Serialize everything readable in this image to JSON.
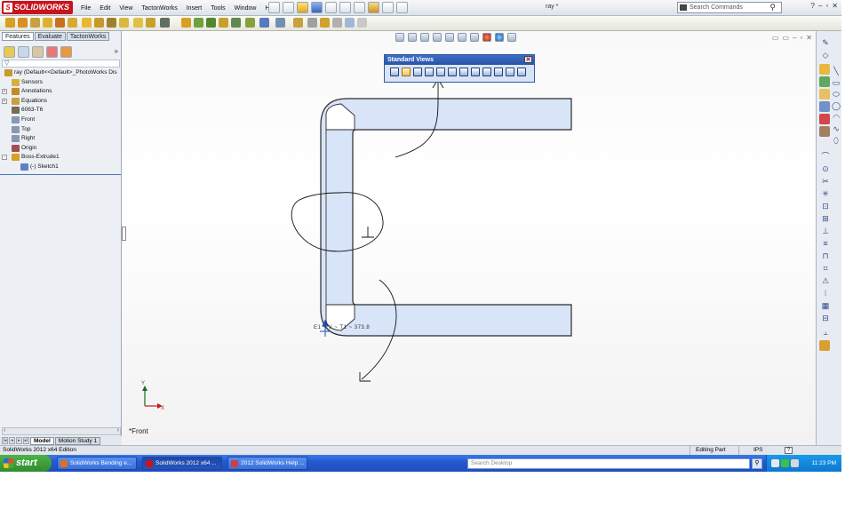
{
  "app": {
    "logo": "SOLIDWORKS",
    "document_title": "ray *",
    "menu": [
      "File",
      "Edit",
      "View",
      "TactonWorks",
      "Insert",
      "Tools",
      "Window",
      "Help"
    ],
    "search_placeholder": "Search Commands"
  },
  "feature_manager": {
    "tabs": [
      "Features",
      "Evaluate",
      "TactonWorks"
    ],
    "tree": [
      {
        "label": "ray  (Default<<Default>_PhotoWorks Dis",
        "expander": "",
        "icon_color": "#c89a2a",
        "indent": 0
      },
      {
        "label": "Sensors",
        "expander": "",
        "icon_color": "#d8b040",
        "indent": 8
      },
      {
        "label": "Annotations",
        "expander": "+",
        "icon_color": "#c88828",
        "indent": 8
      },
      {
        "label": "Equations",
        "expander": "+",
        "icon_color": "#c8a040",
        "indent": 8
      },
      {
        "label": "6063-T6",
        "expander": "",
        "icon_color": "#7a6a5a",
        "indent": 8
      },
      {
        "label": "Front",
        "expander": "",
        "icon_color": "#8898b0",
        "indent": 8
      },
      {
        "label": "Top",
        "expander": "",
        "icon_color": "#8898b0",
        "indent": 8
      },
      {
        "label": "Right",
        "expander": "",
        "icon_color": "#8898b0",
        "indent": 8
      },
      {
        "label": "Origin",
        "expander": "",
        "icon_color": "#a05050",
        "indent": 8
      },
      {
        "label": "Boss-Extrude1",
        "expander": "-",
        "icon_color": "#d8a020",
        "indent": 8
      },
      {
        "label": "(-) Sketch1",
        "expander": "",
        "icon_color": "#6080c0",
        "indent": 18
      }
    ],
    "bottom_tabs": [
      "Model",
      "Motion Study 1"
    ]
  },
  "standard_views": {
    "title": "Standard Views",
    "close_glyph": "✕",
    "buttons": [
      "normal-to",
      "front",
      "back",
      "left",
      "right",
      "top",
      "bottom",
      "isometric",
      "trimetric",
      "dimetric",
      "single-view",
      "view-selector"
    ]
  },
  "viewport": {
    "view_label": "*Front",
    "coordinate_label": "E1 ~ V ~ T1 ~ 373.8",
    "triad_x": "X",
    "triad_y": "Y",
    "sketch_fill": "#d8e4f8",
    "sketch_stroke": "#2a2a2a"
  },
  "status": {
    "product": "SolidWorks 2012 x64 Edition",
    "mode": "Editing Part",
    "units": "IPS",
    "help_glyph": "?"
  },
  "taskbar": {
    "start": "start",
    "buttons": [
      {
        "label": "SolidWorks Bending e...",
        "icon_color": "#e07020"
      },
      {
        "label": "SolidWorks 2012 x64 ...",
        "icon_color": "#c8141c"
      },
      {
        "label": "2012 SolidWorks Help ...",
        "icon_color": "#d04040"
      }
    ],
    "search_placeholder": "Search Desktop",
    "clock": "11:23 PM"
  }
}
